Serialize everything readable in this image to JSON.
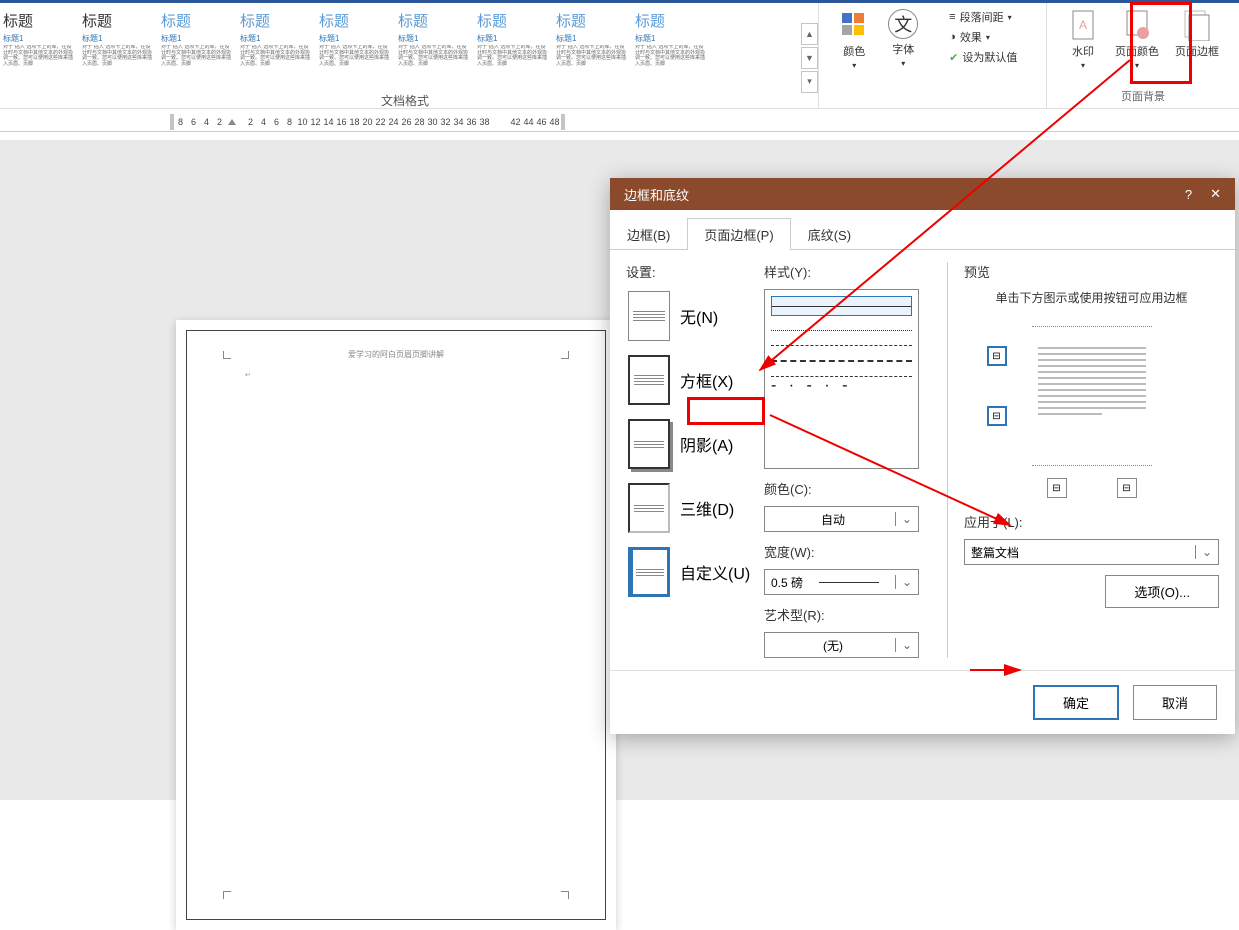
{
  "ribbon": {
    "styles": [
      {
        "title": "标题",
        "titleClass": "dark",
        "sub": "标题1"
      },
      {
        "title": "标题",
        "titleClass": "dark",
        "sub": "标题1"
      },
      {
        "title": "标题",
        "titleClass": "",
        "sub": "标题1"
      },
      {
        "title": "标题",
        "titleClass": "",
        "sub": "标题1"
      },
      {
        "title": "标题",
        "titleClass": "",
        "sub": "标题1"
      },
      {
        "title": "标题",
        "titleClass": "",
        "sub": "标题1"
      },
      {
        "title": "标题",
        "titleClass": "",
        "sub": "标题1"
      },
      {
        "title": "标题",
        "titleClass": "",
        "sub": "标题1"
      },
      {
        "title": "标题",
        "titleClass": "",
        "sub": "标题1"
      }
    ],
    "style_desc": "对于\"插入\"选项卡上的库，在设计时与文档中其他文本的外观协调一致。您可以使用这些库来插入页眉、页脚",
    "group_doc_format": "文档格式",
    "btn_color": "颜色",
    "btn_font": "字体",
    "btn_para_spacing": "段落间距",
    "btn_effects": "效果",
    "btn_set_default": "设为默认值",
    "btn_watermark": "水印",
    "btn_page_color": "页面颜色",
    "btn_page_border": "页面边框",
    "group_page_bg": "页面背景"
  },
  "ruler": {
    "left_ticks": [
      "8",
      "6",
      "4",
      "2"
    ],
    "right_ticks": [
      "2",
      "4",
      "6",
      "8",
      "10",
      "12",
      "14",
      "16",
      "18",
      "20",
      "22",
      "24",
      "26",
      "28",
      "30",
      "32",
      "34",
      "36",
      "38"
    ],
    "far_ticks": [
      "42",
      "44",
      "46",
      "48"
    ]
  },
  "page": {
    "header_text": "爱学习的阿白页眉页脚讲解"
  },
  "dialog": {
    "title": "边框和底纹",
    "help": "?",
    "close": "✕",
    "tabs": {
      "border": "边框(B)",
      "page_border": "页面边框(P)",
      "shading": "底纹(S)"
    },
    "settings_label": "设置:",
    "setting_none": "无(N)",
    "setting_box": "方框(X)",
    "setting_shadow": "阴影(A)",
    "setting_3d": "三维(D)",
    "setting_custom": "自定义(U)",
    "style_label": "样式(Y):",
    "color_label": "颜色(C):",
    "color_value": "自动",
    "width_label": "宽度(W):",
    "width_value": "0.5 磅",
    "art_label": "艺术型(R):",
    "art_value": "(无)",
    "preview_label": "预览",
    "preview_hint": "单击下方图示或使用按钮可应用边框",
    "apply_label": "应用于(L):",
    "apply_value": "整篇文档",
    "btn_options": "选项(O)...",
    "btn_ok": "确定",
    "btn_cancel": "取消"
  }
}
